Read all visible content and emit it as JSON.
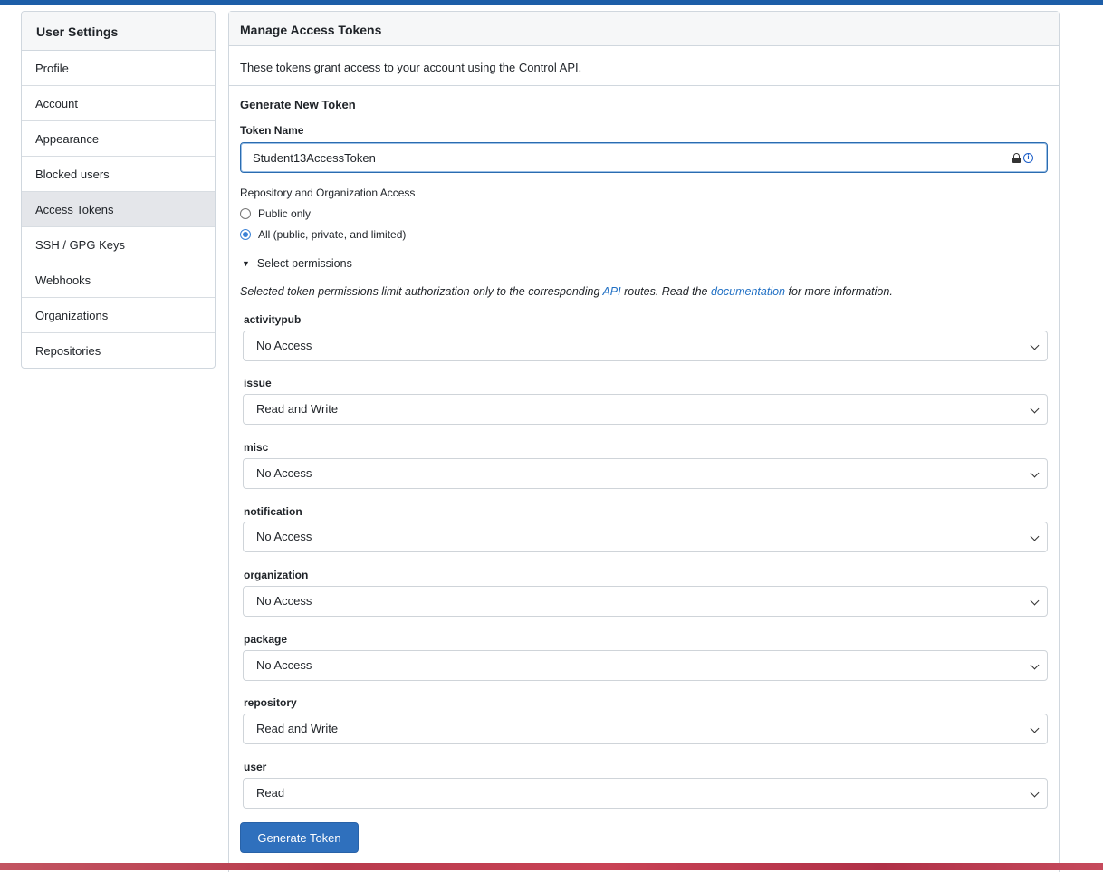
{
  "sidebar": {
    "title": "User Settings",
    "items": [
      {
        "label": "Profile"
      },
      {
        "label": "Account"
      },
      {
        "label": "Appearance"
      },
      {
        "label": "Blocked users"
      },
      {
        "label": "Access Tokens"
      },
      {
        "label": "SSH / GPG Keys"
      },
      {
        "label": "Webhooks"
      },
      {
        "label": "Organizations"
      },
      {
        "label": "Repositories"
      }
    ],
    "active": "Access Tokens"
  },
  "main": {
    "title": "Manage Access Tokens",
    "description": "These tokens grant access to your account using the Control API.",
    "section_title": "Generate New Token",
    "token_name_label": "Token Name",
    "token_name_value": "Student13AccessToken",
    "access_label": "Repository and Organization Access",
    "access_options": [
      {
        "label": "Public only",
        "checked": false
      },
      {
        "label": "All (public, private, and limited)",
        "checked": true
      }
    ],
    "details_summary": "Select permissions",
    "permissions_note": {
      "pre": "Selected token permissions limit authorization only to the corresponding ",
      "link1": "API",
      "mid": " routes. Read the ",
      "link2": "documentation",
      "post": " for more information."
    },
    "permissions": [
      {
        "name": "activitypub",
        "value": "No Access"
      },
      {
        "name": "issue",
        "value": "Read and Write"
      },
      {
        "name": "misc",
        "value": "No Access"
      },
      {
        "name": "notification",
        "value": "No Access"
      },
      {
        "name": "organization",
        "value": "No Access"
      },
      {
        "name": "package",
        "value": "No Access"
      },
      {
        "name": "repository",
        "value": "Read and Write"
      },
      {
        "name": "user",
        "value": "Read"
      }
    ],
    "generate_button": "Generate Token"
  },
  "colors": {
    "accent": "#2f70bd",
    "link": "#2170c4",
    "top_bar": "#1d5ea8"
  }
}
